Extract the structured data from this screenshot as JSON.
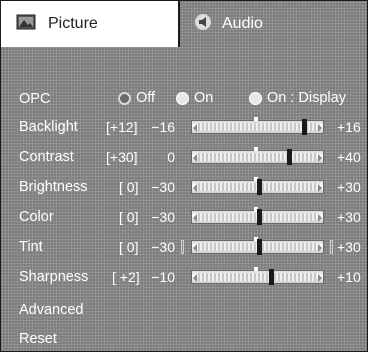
{
  "tabs": [
    {
      "label": "Picture",
      "icon": "picture-icon",
      "selected": true
    },
    {
      "label": "Audio",
      "icon": "audio-icon",
      "selected": false
    }
  ],
  "opc": {
    "label": "OPC",
    "options": [
      {
        "label": "Off",
        "selected": true
      },
      {
        "label": "On",
        "selected": false
      },
      {
        "label": "On : Display",
        "selected": false
      }
    ]
  },
  "sliders": [
    {
      "label": "Backlight",
      "adjust": "[+12]",
      "min": "−16",
      "max": "+16",
      "value": 12,
      "range": [
        -16,
        16
      ]
    },
    {
      "label": "Contrast",
      "adjust": "[+30]",
      "min": "0",
      "max": "+40",
      "value": 30,
      "range": [
        0,
        40
      ]
    },
    {
      "label": "Brightness",
      "adjust": "[ 0]",
      "min": "−30",
      "max": "+30",
      "value": 0,
      "range": [
        -30,
        30
      ]
    },
    {
      "label": "Color",
      "adjust": "[ 0]",
      "min": "−30",
      "max": "+30",
      "value": 0,
      "range": [
        -30,
        30
      ]
    },
    {
      "label": "Tint",
      "adjust": "[ 0]",
      "min": "−30",
      "max": "+30",
      "value": 0,
      "range": [
        -30,
        30
      ]
    },
    {
      "label": "Sharpness",
      "adjust": "[ +2]",
      "min": "−10",
      "max": "+10",
      "value": 2,
      "range": [
        -10,
        10
      ]
    }
  ],
  "menu": {
    "advanced_label": "Advanced",
    "reset_label": "Reset"
  },
  "colors": {
    "background": "#7d7d7d",
    "text": "#ffffff",
    "selected_tab": "#ffffff",
    "thumb": "#1a1a1a"
  }
}
